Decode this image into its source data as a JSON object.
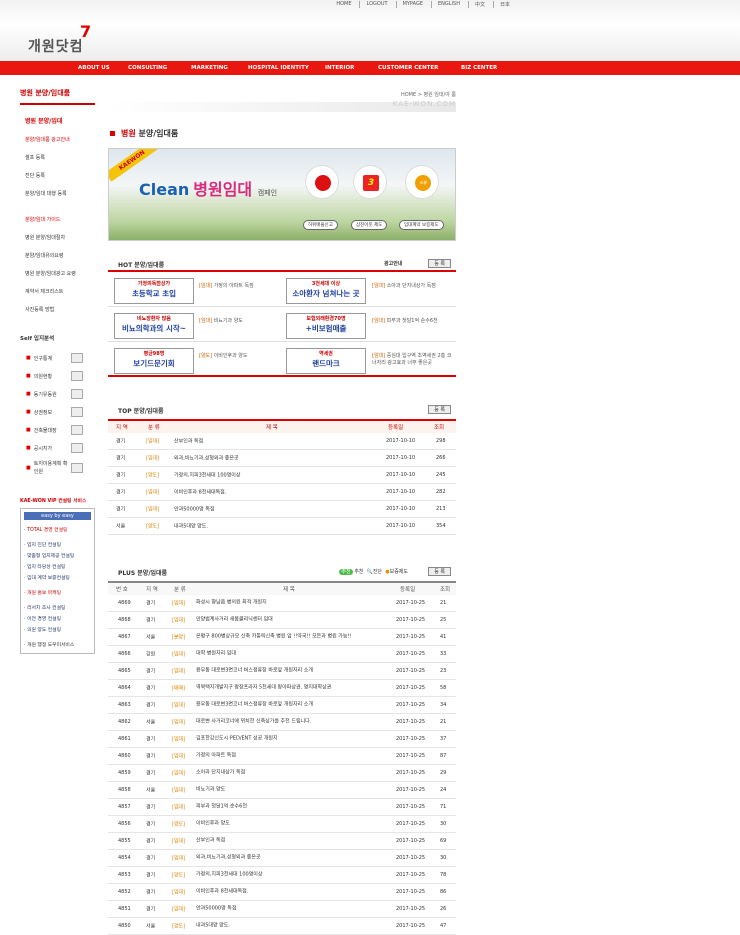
{
  "top_links": [
    "HOME",
    "LOGOUT",
    "MYPAGE",
    "ENGLISH",
    "中文",
    "日本"
  ],
  "logo": {
    "text": "개원닷컴",
    "mark": "7"
  },
  "nav": [
    "ABOUT US",
    "CONSULTING",
    "MARKETING",
    "HOSPITAL IDENTITY",
    "INTERIOR",
    "CUSTOMER CENTER",
    "BIZ CENTER"
  ],
  "sidebar": {
    "title": "병원 분양/임대룸",
    "sub_title": "병원 분양/임대",
    "items1": [
      "분양/임대룸 광고안내",
      "셀프 등록",
      "진단 등록",
      "분양/임대 대행 등록"
    ],
    "guide_title": "분양/임대 가이드",
    "items2": [
      "병원 분양/임대절차",
      "분양/임대유의요령",
      "병원 분양/임대광고 요령",
      "계약서 체크리스트",
      "사진등록 방법"
    ],
    "site_title": "Self 입지분석",
    "site_items": [
      "인구통계",
      "의원현황",
      "동기유동원",
      "상권정보",
      "건축물대장",
      "공시지가",
      "토지이용계획 확인원"
    ],
    "vip_title": "KAE-WON VIP 컨설팅 서비스",
    "vip_bar": "easy by easy",
    "vip_items": [
      "TOTAL 경영 컨설팅",
      "입지 진단 컨설팅",
      "맞춤형 입지제공 컨설팅",
      "입지 타당성 컨설팅",
      "임대 계약 보증컨설팅",
      "개원 홍보 마케팅",
      "리서치 조사 컨설팅",
      "이전 경영 컨설팅",
      "의원 양도 컨설팅",
      "개원 행정 도우미서비스"
    ]
  },
  "main": {
    "breadcrumb": "HOME > 병원 임대/야 룸",
    "watermark": "KAE-WON.COM",
    "title_red": "병원",
    "title_rest": "분양/임대룸",
    "banner": {
      "tag": "KAEWON",
      "clean": "Clean",
      "pink": "병원임대",
      "small": "캠페인",
      "buttons": [
        "허위매물신고",
        "삼진아웃 제도",
        "임대계약 보증제도"
      ],
      "badge3": "3",
      "badge_label": "보증"
    },
    "hot": {
      "title": "HOT 분양/임대룸",
      "ad_label": "광고안내",
      "more": "등 록",
      "items": [
        {
          "ad_top": "가정의독점상가",
          "ad_main": "초등학교 초입",
          "cat": "[임대]",
          "text": "가정의 아파트 독점"
        },
        {
          "ad_top": "3천세대 이상",
          "ad_main": "소아환자 넘쳐나는 곳",
          "cat": "[임대]",
          "text": "소아과 단지내상가 독점"
        },
        {
          "ad_top": "비뇨장환자 많음",
          "ad_main": "비뇨의학과의 시작~",
          "cat": "[임대]",
          "text": "비뇨기과 양도"
        },
        {
          "ad_top": "보험외래환경70명",
          "ad_main": "+비보험매출",
          "cat": "[임대]",
          "text": "피부과 첫달1억 순수6천"
        },
        {
          "ad_top": "평균98명",
          "ad_main": "보기드문기회",
          "cat": "[양도]",
          "text": "이비인후과 양도"
        },
        {
          "ad_top": "역세권",
          "ad_main": "랜드마크",
          "cat": "[임대]",
          "text": "중심대 입구역 초역세권 2층 코너자리 광고효과 너무 좋은곳"
        }
      ]
    },
    "top_table": {
      "title": "TOP 분양/임대룸",
      "more": "등 록",
      "headers": [
        "지 역",
        "분 류",
        "제 목",
        "등록일",
        "조회"
      ],
      "rows": [
        [
          "경기",
          "[임대]",
          "산부인과 독점",
          "2017-10-10",
          "298"
        ],
        [
          "경기",
          "[임대]",
          "외과,비뇨기과,성형외과 좋은곳",
          "2017-10-10",
          "266"
        ],
        [
          "경기",
          "[양도]",
          "가정의,지피3천세대 100명이상",
          "2017-10-10",
          "245"
        ],
        [
          "경기",
          "[임대]",
          "이비인후과 8천세대독점.",
          "2017-10-10",
          "282"
        ],
        [
          "경기",
          "[임대]",
          "안과50000명 독점",
          "2017-10-10",
          "213"
        ],
        [
          "서울",
          "[양도]",
          "내과5대양 양도.",
          "2017-10-10",
          "354"
        ]
      ]
    },
    "plus_table": {
      "title": "PLUS 분양/임대룸",
      "icons": [
        "추천",
        "진단",
        "보증제도"
      ],
      "icon_num": "추천",
      "more": "등 록",
      "headers": [
        "번 호",
        "지 역",
        "분 류",
        "제 목",
        "등록일",
        "조회"
      ],
      "rows": [
        [
          "4869",
          "경기",
          "[임대]",
          "화성시 향남읍 병의원 최적 개원지",
          "2017-10-25",
          "21"
        ],
        [
          "4868",
          "경기",
          "[임대]",
          "안양범계사거리 새봄클리닉센터 임대",
          "2017-10-25",
          "25"
        ],
        [
          "4867",
          "서울",
          "[분양]",
          "은평구 800병상규모 신축 카톨릭신축 병원 앞 !!약국!! 모든과 병원 가능!!",
          "2017-10-25",
          "41"
        ],
        [
          "4866",
          "강원",
          "[임대]",
          "대학 병원자리 임대",
          "2017-10-25",
          "33"
        ],
        [
          "4865",
          "경기",
          "[임대]",
          "용무동 대로변3면코너 버스정류장 바로앞 개원자리 소개",
          "2017-10-25",
          "23"
        ],
        [
          "4864",
          "경기",
          "[매매]",
          "역북택지개발지구 랑장프라자 5천세대 랑아파상권, 명지대학상권",
          "2017-10-25",
          "58"
        ],
        [
          "4863",
          "경기",
          "[임대]",
          "용무동 대로변3면코너 버스정류장 바로앞 개원자리 소개",
          "2017-10-25",
          "34"
        ],
        [
          "4862",
          "서울",
          "[임대]",
          "대로변 사거리코너에 위치한 신축상가를 추천 드립니다.",
          "2017-10-25",
          "21"
        ],
        [
          "4861",
          "경기",
          "[임대]",
          "김포한강신도시 PED/ENT 성공 개원지",
          "2017-10-25",
          "37"
        ],
        [
          "4860",
          "경기",
          "[임대]",
          "가정의 아파트 독점",
          "2017-10-25",
          "87"
        ],
        [
          "4859",
          "경기",
          "[임대]",
          "소아과 단지내상가 독점",
          "2017-10-25",
          "29"
        ],
        [
          "4858",
          "서울",
          "[임대]",
          "비뇨기과 양도",
          "2017-10-25",
          "24"
        ],
        [
          "4857",
          "경기",
          "[임대]",
          "피부과 첫달1억 순수6천",
          "2017-10-25",
          "71"
        ],
        [
          "4856",
          "경기",
          "[양도]",
          "이비인후과 양도",
          "2017-10-25",
          "30"
        ],
        [
          "4855",
          "경기",
          "[임대]",
          "산부인과 독점",
          "2017-10-25",
          "69"
        ],
        [
          "4854",
          "경기",
          "[임대]",
          "외과,비뇨기과,성형외과 좋은곳",
          "2017-10-25",
          "30"
        ],
        [
          "4853",
          "경기",
          "[양도]",
          "가정의,지피3천세대 100명이상",
          "2017-10-25",
          "78"
        ],
        [
          "4852",
          "경기",
          "[임대]",
          "이비인후과 8천세대독점.",
          "2017-10-25",
          "86"
        ],
        [
          "4851",
          "경기",
          "[임대]",
          "안과50000명 독점",
          "2017-10-25",
          "26"
        ],
        [
          "4850",
          "서울",
          "[양도]",
          "내과5대양 양도.",
          "2017-10-25",
          "47"
        ]
      ]
    }
  }
}
